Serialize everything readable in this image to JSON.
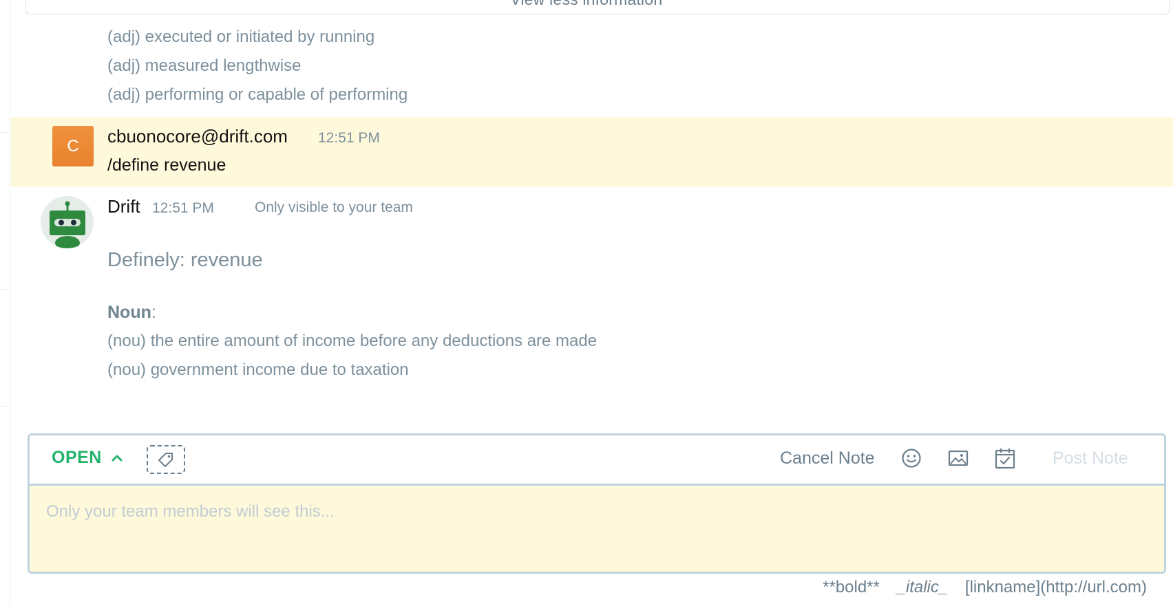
{
  "view_less": {
    "label": "View less information"
  },
  "definitions_adj": [
    "(adj) executed or initiated by running",
    "(adj) measured lengthwise",
    "(adj) performing or capable of performing"
  ],
  "user_message": {
    "avatar_initial": "C",
    "author": "cbuonocore@drift.com",
    "time": "12:51 PM",
    "text": "/define revenue"
  },
  "bot_message": {
    "author": "Drift",
    "time": "12:51 PM",
    "visibility": "Only visible to your team",
    "title": "Definely: revenue",
    "part_of_speech": "Noun",
    "part_of_speech_suffix": ":",
    "definitions": [
      "(nou) the entire amount of income before any deductions are made",
      "(nou) government income due to taxation"
    ]
  },
  "composer": {
    "status": "OPEN",
    "cancel_label": "Cancel Note",
    "post_label": "Post Note",
    "placeholder": "Only your team members will see this...",
    "icons": [
      "chevron-up-icon",
      "tag-icon",
      "emoji-icon",
      "image-icon",
      "calendar-check-icon"
    ]
  },
  "format_hints": {
    "bold": "**bold**",
    "italic": "_italic_",
    "link": "[linkname](http://url.com)"
  },
  "colors": {
    "highlight": "#fff9db",
    "accent_green": "#20b36b",
    "avatar_orange": "#ee8c37",
    "muted_text": "#7d909c",
    "border": "#bfd3df"
  }
}
